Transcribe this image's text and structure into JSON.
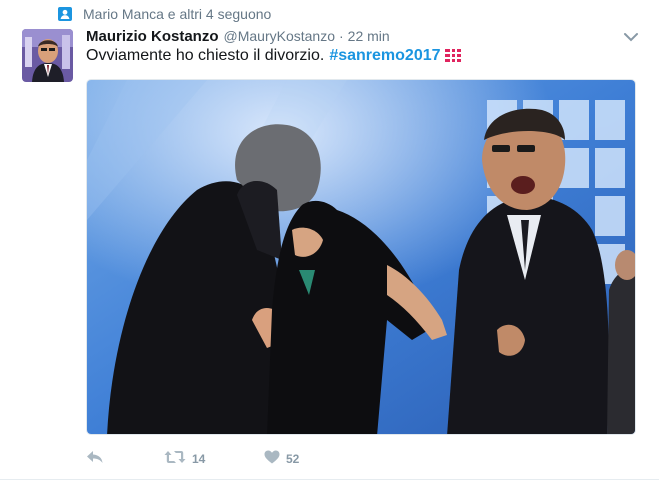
{
  "context": {
    "text": "Mario Manca e altri 4 seguono"
  },
  "header": {
    "fullname": "Maurizio Kostanzo",
    "username": "@MauryKostanzo",
    "separator": "·",
    "time": "22 min"
  },
  "tweet": {
    "text": "Ovviamente ho chiesto il divorzio.",
    "hashtag": "#sanremo2017"
  },
  "actions": {
    "retweet_count": "14",
    "like_count": "52"
  },
  "colors": {
    "link": "#1b95e0",
    "muted": "#657786",
    "action": "#8899a6"
  }
}
